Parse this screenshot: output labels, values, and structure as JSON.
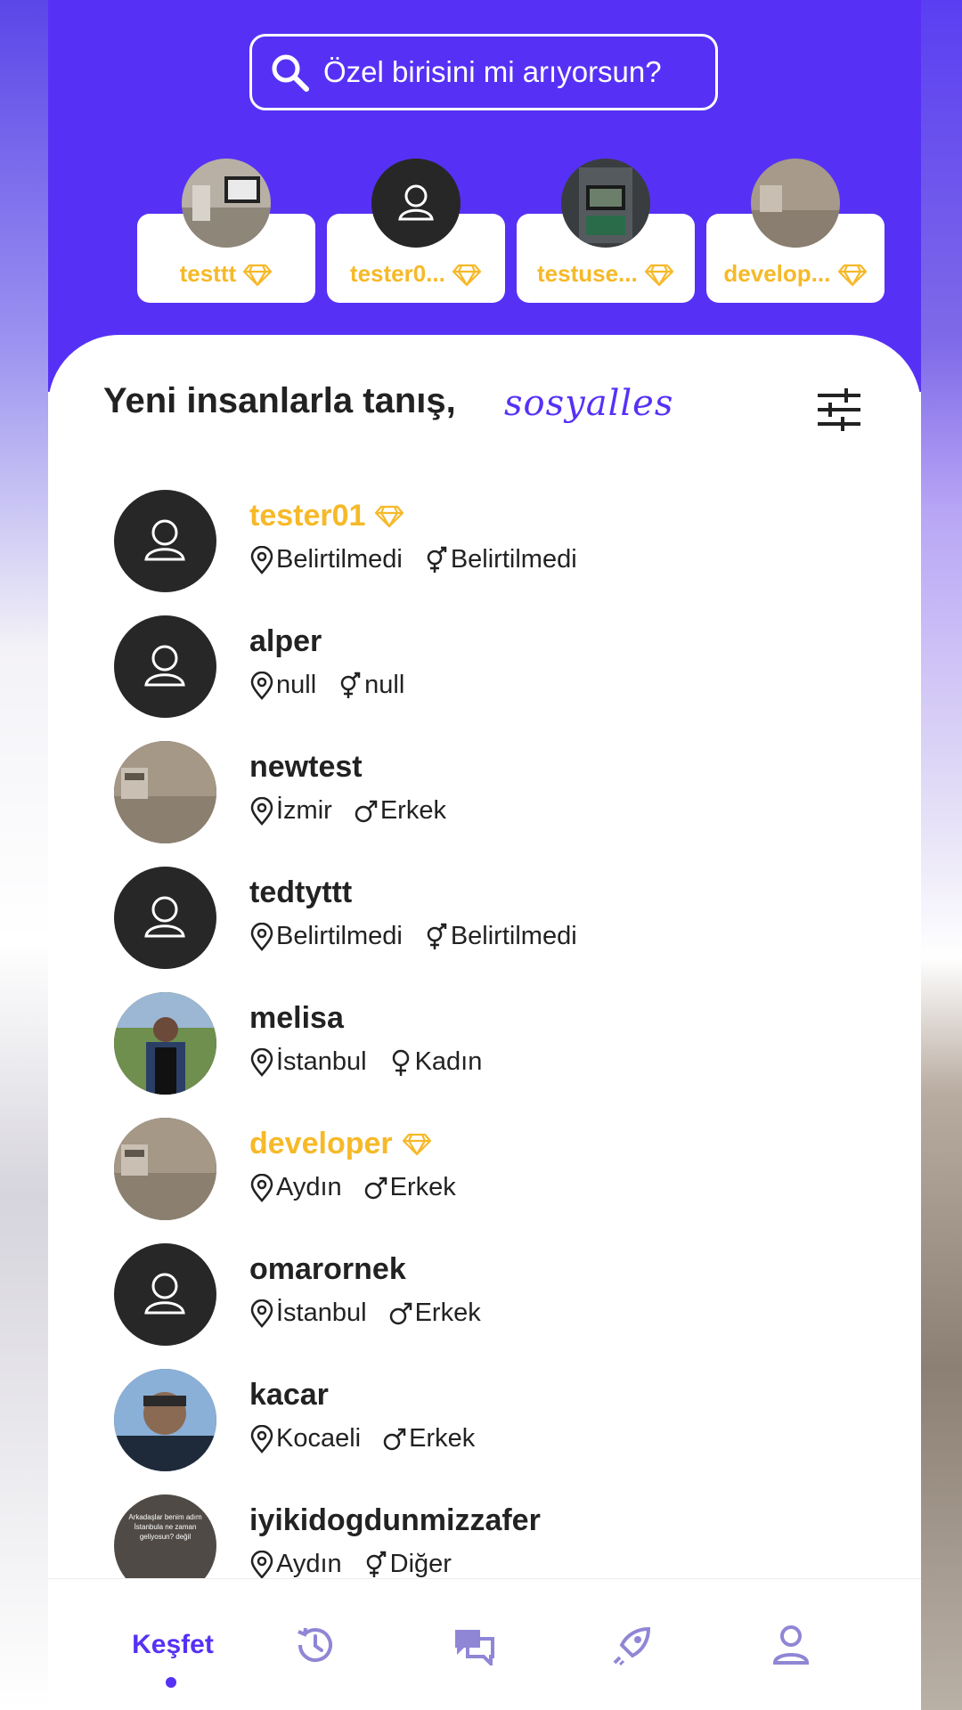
{
  "search": {
    "placeholder": "Özel birisini mi arıyorsun?"
  },
  "stories": [
    {
      "name": "testtt",
      "avatar": "room-photo"
    },
    {
      "name": "tester0...",
      "avatar": "default-user"
    },
    {
      "name": "testuse...",
      "avatar": "machine-photo"
    },
    {
      "name": "develop...",
      "avatar": "room-photo"
    }
  ],
  "header": {
    "title": "Yeni insanlarla tanış,",
    "brand_script": "sosyalles"
  },
  "users": [
    {
      "username": "tester01",
      "premium": true,
      "location": "Belirtilmedi",
      "gender": "Belirtilmedi",
      "gender_icon": "unspecified",
      "avatar": "default-user"
    },
    {
      "username": "alper",
      "premium": false,
      "location": "null",
      "gender": "null",
      "gender_icon": "unspecified",
      "avatar": "default-user"
    },
    {
      "username": "newtest",
      "premium": false,
      "location": "İzmir",
      "gender": "Erkek",
      "gender_icon": "male",
      "avatar": "room-photo"
    },
    {
      "username": "tedtyttt",
      "premium": false,
      "location": "Belirtilmedi",
      "gender": "Belirtilmedi",
      "gender_icon": "unspecified",
      "avatar": "default-user"
    },
    {
      "username": "melisa",
      "premium": false,
      "location": "İstanbul",
      "gender": "Kadın",
      "gender_icon": "female",
      "avatar": "person-photo"
    },
    {
      "username": "developer",
      "premium": true,
      "location": "Aydın",
      "gender": "Erkek",
      "gender_icon": "male",
      "avatar": "room-photo"
    },
    {
      "username": "omarornek",
      "premium": false,
      "location": "İstanbul",
      "gender": "Erkek",
      "gender_icon": "male",
      "avatar": "default-user"
    },
    {
      "username": "kacar",
      "premium": false,
      "location": "Kocaeli",
      "gender": "Erkek",
      "gender_icon": "male",
      "avatar": "selfie-photo"
    },
    {
      "username": "iyikidogdunmizzafer",
      "premium": false,
      "location": "Aydın",
      "gender": "Diğer",
      "gender_icon": "unspecified",
      "avatar": "text-photo",
      "avatar_text": "Arkadaşlar benim adım İstanbula ne zaman geliyosun? değil"
    }
  ],
  "nav": {
    "items": [
      {
        "label": "Keşfet",
        "icon": "compass",
        "active": true
      },
      {
        "label": "",
        "icon": "history-icon"
      },
      {
        "label": "",
        "icon": "chat-icon"
      },
      {
        "label": "",
        "icon": "rocket-icon"
      },
      {
        "label": "",
        "icon": "profile-icon"
      }
    ]
  },
  "colors": {
    "primary": "#5631f5",
    "premium": "#f6b928",
    "avatar_bg": "#272727"
  }
}
